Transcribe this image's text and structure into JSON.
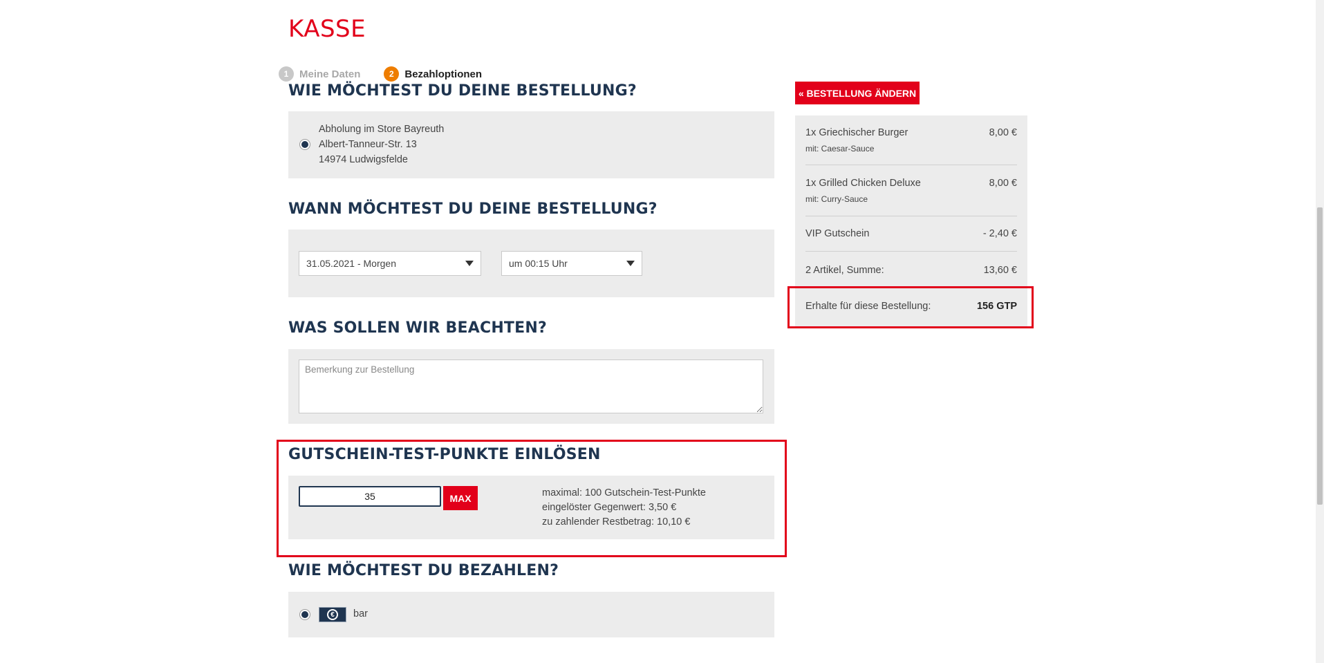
{
  "page": {
    "title": "KASSE"
  },
  "steps": [
    {
      "num": "1",
      "label": "Meine Daten"
    },
    {
      "num": "2",
      "label": "Bezahloptionen"
    }
  ],
  "delivery": {
    "title": "WIE MÖCHTEST DU DEINE BESTELLUNG?",
    "address_lines": [
      "Abholung im Store Bayreuth",
      "Albert-Tanneur-Str. 13",
      "14974 Ludwigsfelde"
    ]
  },
  "timing": {
    "title": "WANN MÖCHTEST DU DEINE BESTELLUNG?",
    "date_value": "31.05.2021 - Morgen",
    "time_value": "um 00:15 Uhr"
  },
  "notes": {
    "title": "WAS SOLLEN WIR BEACHTEN?",
    "placeholder": "Bemerkung zur Bestellung"
  },
  "points": {
    "title": "GUTSCHEIN-TEST-PUNKTE EINLÖSEN",
    "value": "35",
    "max_label": "MAX",
    "info": [
      "maximal: 100 Gutschein-Test-Punkte",
      "eingelöster Gegenwert: 3,50 €",
      "zu zahlender Restbetrag: 10,10 €"
    ]
  },
  "payment": {
    "title": "WIE MÖCHTEST DU BEZAHLEN?",
    "option_label": "bar",
    "icon": "cash-icon",
    "coin_symbol": "€"
  },
  "sidebar": {
    "change_button": "« BESTELLUNG ÄNDERN",
    "items": [
      {
        "name": "1x Griechischer Burger",
        "sub": "mit: Caesar-Sauce",
        "price": "8,00 €"
      },
      {
        "name": "1x Grilled Chicken Deluxe",
        "sub": "mit: Curry-Sauce",
        "price": "8,00 €"
      }
    ],
    "voucher": {
      "label": "VIP Gutschein",
      "value": "- 2,40 €"
    },
    "total": {
      "label": "2 Artikel, Summe:",
      "value": "13,60 €"
    },
    "earn": {
      "label": "Erhalte für diese Bestellung:",
      "value": "156 GTP"
    }
  },
  "colors": {
    "brand_red": "#e2001a",
    "navy": "#1f3550",
    "step_orange": "#ee7d00"
  }
}
